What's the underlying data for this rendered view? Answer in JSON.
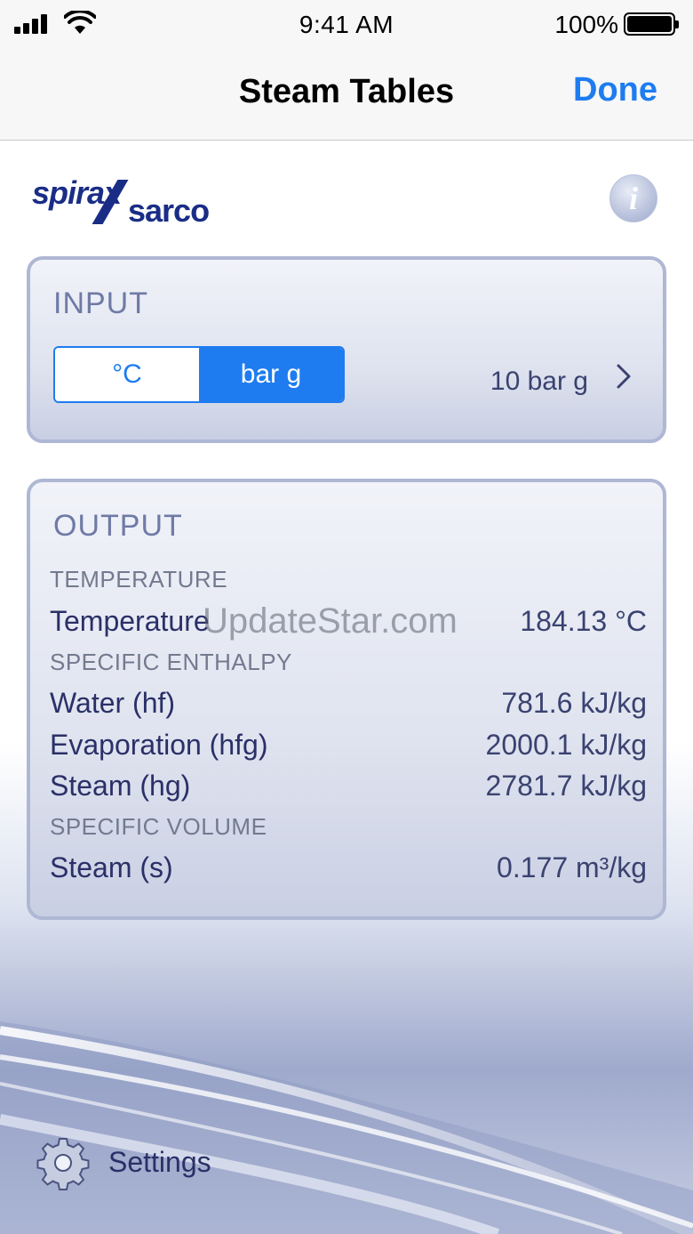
{
  "status_bar": {
    "time": "9:41 AM",
    "battery_percent": "100%",
    "signal_icon": "cellular-signal-icon",
    "wifi_icon": "wifi-icon",
    "battery_icon": "battery-icon"
  },
  "nav": {
    "title": "Steam Tables",
    "done_label": "Done"
  },
  "brand": {
    "logo_word_1": "spirax",
    "logo_word_2": "sarco",
    "logo_color": "#1a2d86",
    "info_icon": "info-icon",
    "info_glyph": "i"
  },
  "input": {
    "title": "INPUT",
    "segments": [
      {
        "label": "°C",
        "selected": false
      },
      {
        "label": "bar g",
        "selected": true
      }
    ],
    "value": "10 bar g",
    "accent_color": "#1e7cf0",
    "chevron_icon": "chevron-right-icon"
  },
  "output": {
    "title": "OUTPUT",
    "sections": [
      {
        "label": "TEMPERATURE",
        "rows": [
          {
            "label": "Temperature",
            "value": "184.13 °C"
          }
        ]
      },
      {
        "label": "SPECIFIC ENTHALPY",
        "rows": [
          {
            "label": "Water (hf)",
            "value": "781.6 kJ/kg"
          },
          {
            "label": "Evaporation (hfg)",
            "value": "2000.1 kJ/kg"
          },
          {
            "label": "Steam (hg)",
            "value": "2781.7 kJ/kg"
          }
        ]
      },
      {
        "label": "SPECIFIC VOLUME",
        "rows": [
          {
            "label": "Steam (s)",
            "value": "0.177 m³/kg"
          }
        ]
      }
    ]
  },
  "watermark": "UpdateStar.com",
  "footer": {
    "settings_label": "Settings",
    "settings_icon": "gear-icon"
  }
}
